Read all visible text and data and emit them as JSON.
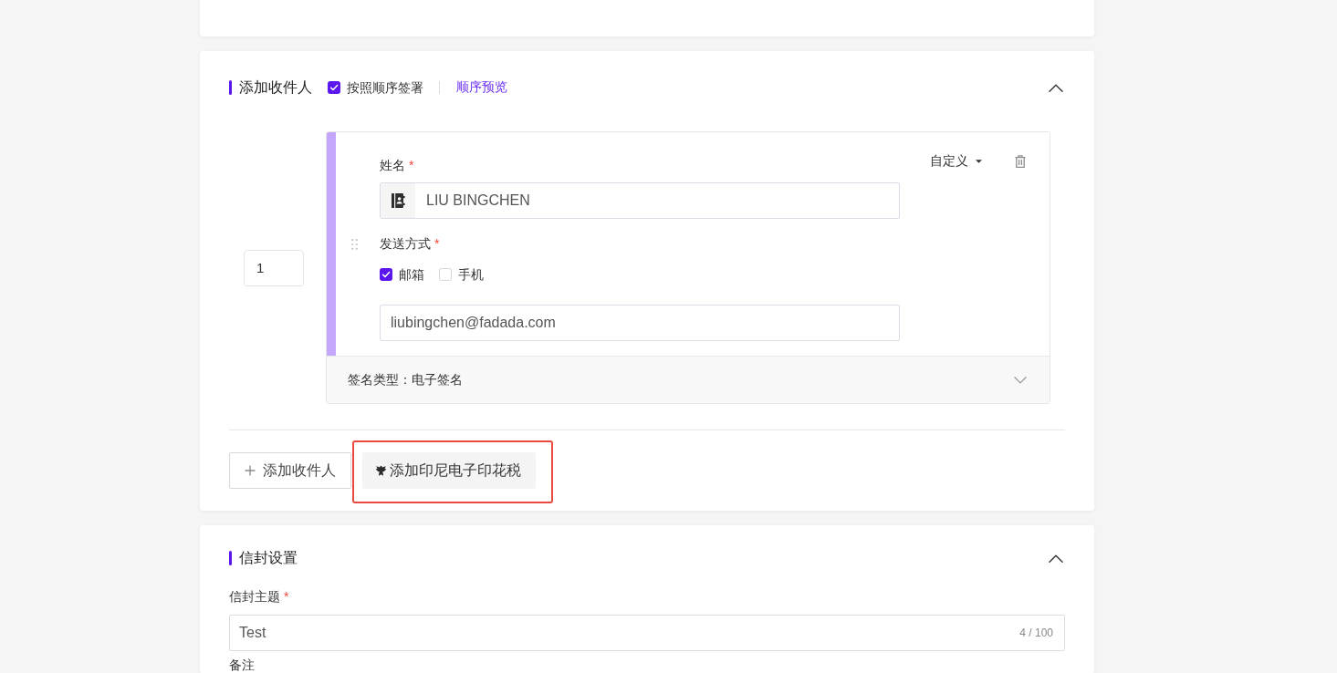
{
  "recipients_section": {
    "title": "添加收件人",
    "expanded": true,
    "sequential_signing": {
      "label": "按照顺序签署",
      "checked": true
    },
    "preview_link": "顺序预览",
    "recipients": [
      {
        "order": "1",
        "role": "自定义",
        "name_label": "姓名",
        "name_required_mark": "*",
        "name": "LIU BINGCHEN",
        "send_method_label": "发送方式",
        "send_method_required_mark": "*",
        "send_methods": [
          {
            "label": "邮箱",
            "checked": true
          },
          {
            "label": "手机",
            "checked": false
          }
        ],
        "email": "liubingchen@fadada.com",
        "signature_type": "签名类型：电子签名",
        "expanded": false
      }
    ],
    "buttons": [
      {
        "kind": "add",
        "label": "添加收件人",
        "highlighted": false
      },
      {
        "kind": "stamp",
        "label": "添加印尼电子印花税",
        "highlighted": true
      }
    ]
  },
  "envelope_section": {
    "title": "信封设置",
    "expanded": true,
    "fields": [
      {
        "label": "信封主题",
        "required_mark": "*",
        "value": "Test",
        "counter": "4 / 100"
      },
      {
        "label": "备注"
      }
    ]
  }
}
